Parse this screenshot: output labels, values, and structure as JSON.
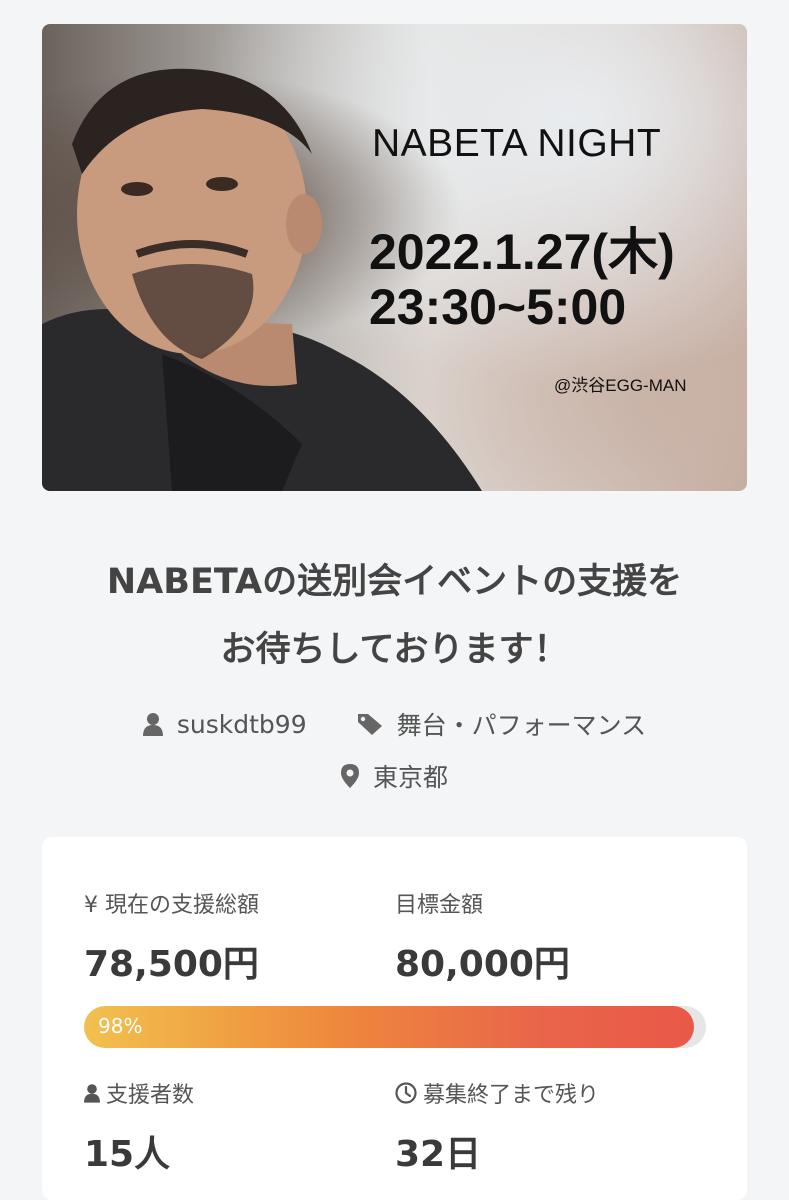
{
  "hero": {
    "title": "NABETA NIGHT",
    "date": "2022.1.27(木)",
    "time": "23:30~5:00",
    "venue": "@渋谷EGG-MAN"
  },
  "project": {
    "title_line1": "NABETAの送別会イベントの支援を",
    "title_line2": "お待ちしております！",
    "owner": "suskdtb99",
    "category": "舞台・パフォーマンス",
    "location": "東京都"
  },
  "stats": {
    "current_label": "¥ 現在の支援総額",
    "current_value": "78,500円",
    "goal_label": "目標金額",
    "goal_value": "80,000円",
    "progress_text": "98%",
    "progress_percent": 98,
    "supporters_label": "支援者数",
    "supporters_value": "15人",
    "remaining_label": "募集終了まで残り",
    "remaining_value": "32日"
  },
  "colors": {
    "progress_start": "#f2c14e",
    "progress_end": "#e95848",
    "background": "#f4f5f7"
  }
}
